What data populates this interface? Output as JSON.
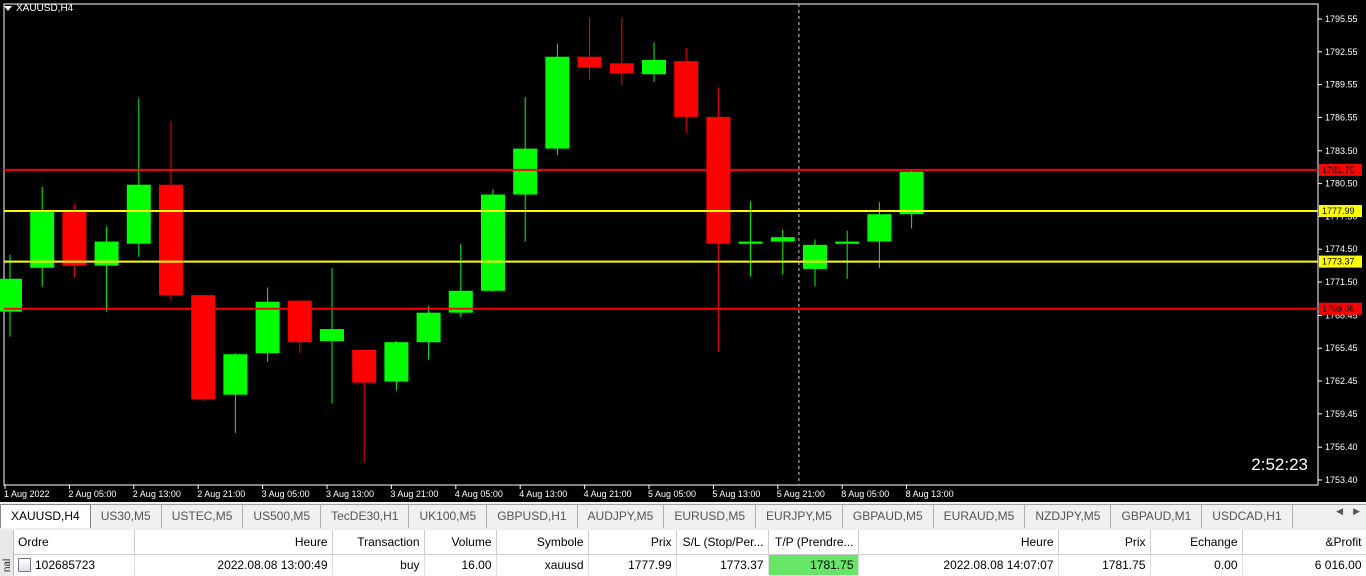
{
  "chart": {
    "title": "XAUUSD,H4",
    "timer": "2:52:23",
    "colors": {
      "background": "#000000",
      "bull": "#00ff00",
      "bear": "#ff0000",
      "axis": "#ffffff",
      "tp_line": "#ff0000",
      "sl_line": "#ffff00"
    }
  },
  "chart_data": {
    "type": "candlestick",
    "title": "XAUUSD,H4",
    "ylim": [
      1753.4,
      1797.0
    ],
    "y_ticks": [
      "1795.55",
      "1792.55",
      "1789.55",
      "1786.55",
      "1783.50",
      "1780.50",
      "1777.50",
      "1774.50",
      "1771.50",
      "1768.45",
      "1765.45",
      "1762.45",
      "1759.45",
      "1756.40",
      "1753.40"
    ],
    "x_ticks": [
      "1 Aug 2022",
      "2 Aug 05:00",
      "2 Aug 13:00",
      "2 Aug 21:00",
      "3 Aug 05:00",
      "3 Aug 13:00",
      "3 Aug 21:00",
      "4 Aug 05:00",
      "4 Aug 13:00",
      "4 Aug 21:00",
      "5 Aug 05:00",
      "5 Aug 13:00",
      "5 Aug 21:00",
      "8 Aug 05:00",
      "8 Aug 13:00"
    ],
    "candles": [
      {
        "o": 1768.8,
        "h": 1774.0,
        "l": 1766.5,
        "c": 1771.8
      },
      {
        "o": 1772.8,
        "h": 1780.2,
        "l": 1771.1,
        "c": 1777.9
      },
      {
        "o": 1777.9,
        "h": 1778.6,
        "l": 1771.9,
        "c": 1773.0
      },
      {
        "o": 1773.0,
        "h": 1776.6,
        "l": 1768.8,
        "c": 1775.2
      },
      {
        "o": 1775.0,
        "h": 1788.3,
        "l": 1773.8,
        "c": 1780.4
      },
      {
        "o": 1780.4,
        "h": 1786.2,
        "l": 1769.8,
        "c": 1770.3
      },
      {
        "o": 1770.3,
        "h": 1770.3,
        "l": 1760.6,
        "c": 1760.8
      },
      {
        "o": 1761.2,
        "h": 1765.0,
        "l": 1757.7,
        "c": 1764.9
      },
      {
        "o": 1765.0,
        "h": 1771.0,
        "l": 1764.2,
        "c": 1769.7
      },
      {
        "o": 1769.8,
        "h": 1769.8,
        "l": 1765.0,
        "c": 1766.0
      },
      {
        "o": 1766.1,
        "h": 1772.8,
        "l": 1760.4,
        "c": 1767.2
      },
      {
        "o": 1765.3,
        "h": 1765.3,
        "l": 1755.0,
        "c": 1762.3
      },
      {
        "o": 1762.4,
        "h": 1766.1,
        "l": 1761.6,
        "c": 1766.0
      },
      {
        "o": 1766.0,
        "h": 1769.3,
        "l": 1764.4,
        "c": 1768.7
      },
      {
        "o": 1768.7,
        "h": 1775.0,
        "l": 1768.3,
        "c": 1770.7
      },
      {
        "o": 1770.7,
        "h": 1780.0,
        "l": 1770.6,
        "c": 1779.5
      },
      {
        "o": 1779.5,
        "h": 1788.4,
        "l": 1775.2,
        "c": 1783.7
      },
      {
        "o": 1783.7,
        "h": 1793.3,
        "l": 1783.1,
        "c": 1792.1
      },
      {
        "o": 1792.1,
        "h": 1795.7,
        "l": 1790.0,
        "c": 1791.1
      },
      {
        "o": 1791.5,
        "h": 1795.7,
        "l": 1789.5,
        "c": 1790.6
      },
      {
        "o": 1790.5,
        "h": 1793.4,
        "l": 1789.8,
        "c": 1791.8
      },
      {
        "o": 1791.7,
        "h": 1792.9,
        "l": 1785.1,
        "c": 1786.6
      },
      {
        "o": 1786.6,
        "h": 1789.3,
        "l": 1765.1,
        "c": 1775.0
      },
      {
        "o": 1775.0,
        "h": 1778.9,
        "l": 1772.0,
        "c": 1775.2
      },
      {
        "o": 1775.2,
        "h": 1776.3,
        "l": 1772.2,
        "c": 1775.6
      },
      {
        "o": 1772.7,
        "h": 1775.4,
        "l": 1771.1,
        "c": 1774.9
      },
      {
        "o": 1775.0,
        "h": 1776.2,
        "l": 1771.8,
        "c": 1775.2
      },
      {
        "o": 1775.2,
        "h": 1778.8,
        "l": 1772.8,
        "c": 1777.7
      },
      {
        "o": 1777.7,
        "h": 1781.7,
        "l": 1776.4,
        "c": 1781.6
      }
    ],
    "price_lines": [
      {
        "price": 1781.75,
        "label": "1781.75",
        "color": "#ff0000"
      },
      {
        "price": 1777.99,
        "label": "1777.99",
        "color": "#ffff00"
      },
      {
        "price": 1773.37,
        "label": "1773.37",
        "color": "#ffff00"
      },
      {
        "price": 1769.06,
        "label": "1769.06",
        "color": "#ff0000"
      }
    ],
    "crosshair_after_candle": 24
  },
  "tabs": [
    "XAUUSD,H4",
    "US30,M5",
    "USTEC,M5",
    "US500,M5",
    "TecDE30,H1",
    "UK100,M5",
    "GBPUSD,H1",
    "AUDJPY,M5",
    "EURUSD,M5",
    "EURJPY,M5",
    "GBPAUD,M5",
    "EURAUD,M5",
    "NZDJPY,M5",
    "GBPAUD,M1",
    "USDCAD,H1"
  ],
  "active_tab": 0,
  "terminal": {
    "side_label": "nal",
    "columns": [
      "Ordre",
      "Heure",
      "Transaction",
      "Volume",
      "Symbole",
      "Prix",
      "S/L (Stop/Per...",
      "T/P (Prendre...",
      "Heure",
      "Prix",
      "Echange",
      "&Profit"
    ],
    "rows": [
      [
        "102685723",
        "2022.08.08 13:00:49",
        "buy",
        "16.00",
        "xauusd",
        "1777.99",
        "1773.37",
        "1781.75",
        "2022.08.08 14:07:07",
        "1781.75",
        "0.00",
        "6 016.00"
      ]
    ]
  }
}
